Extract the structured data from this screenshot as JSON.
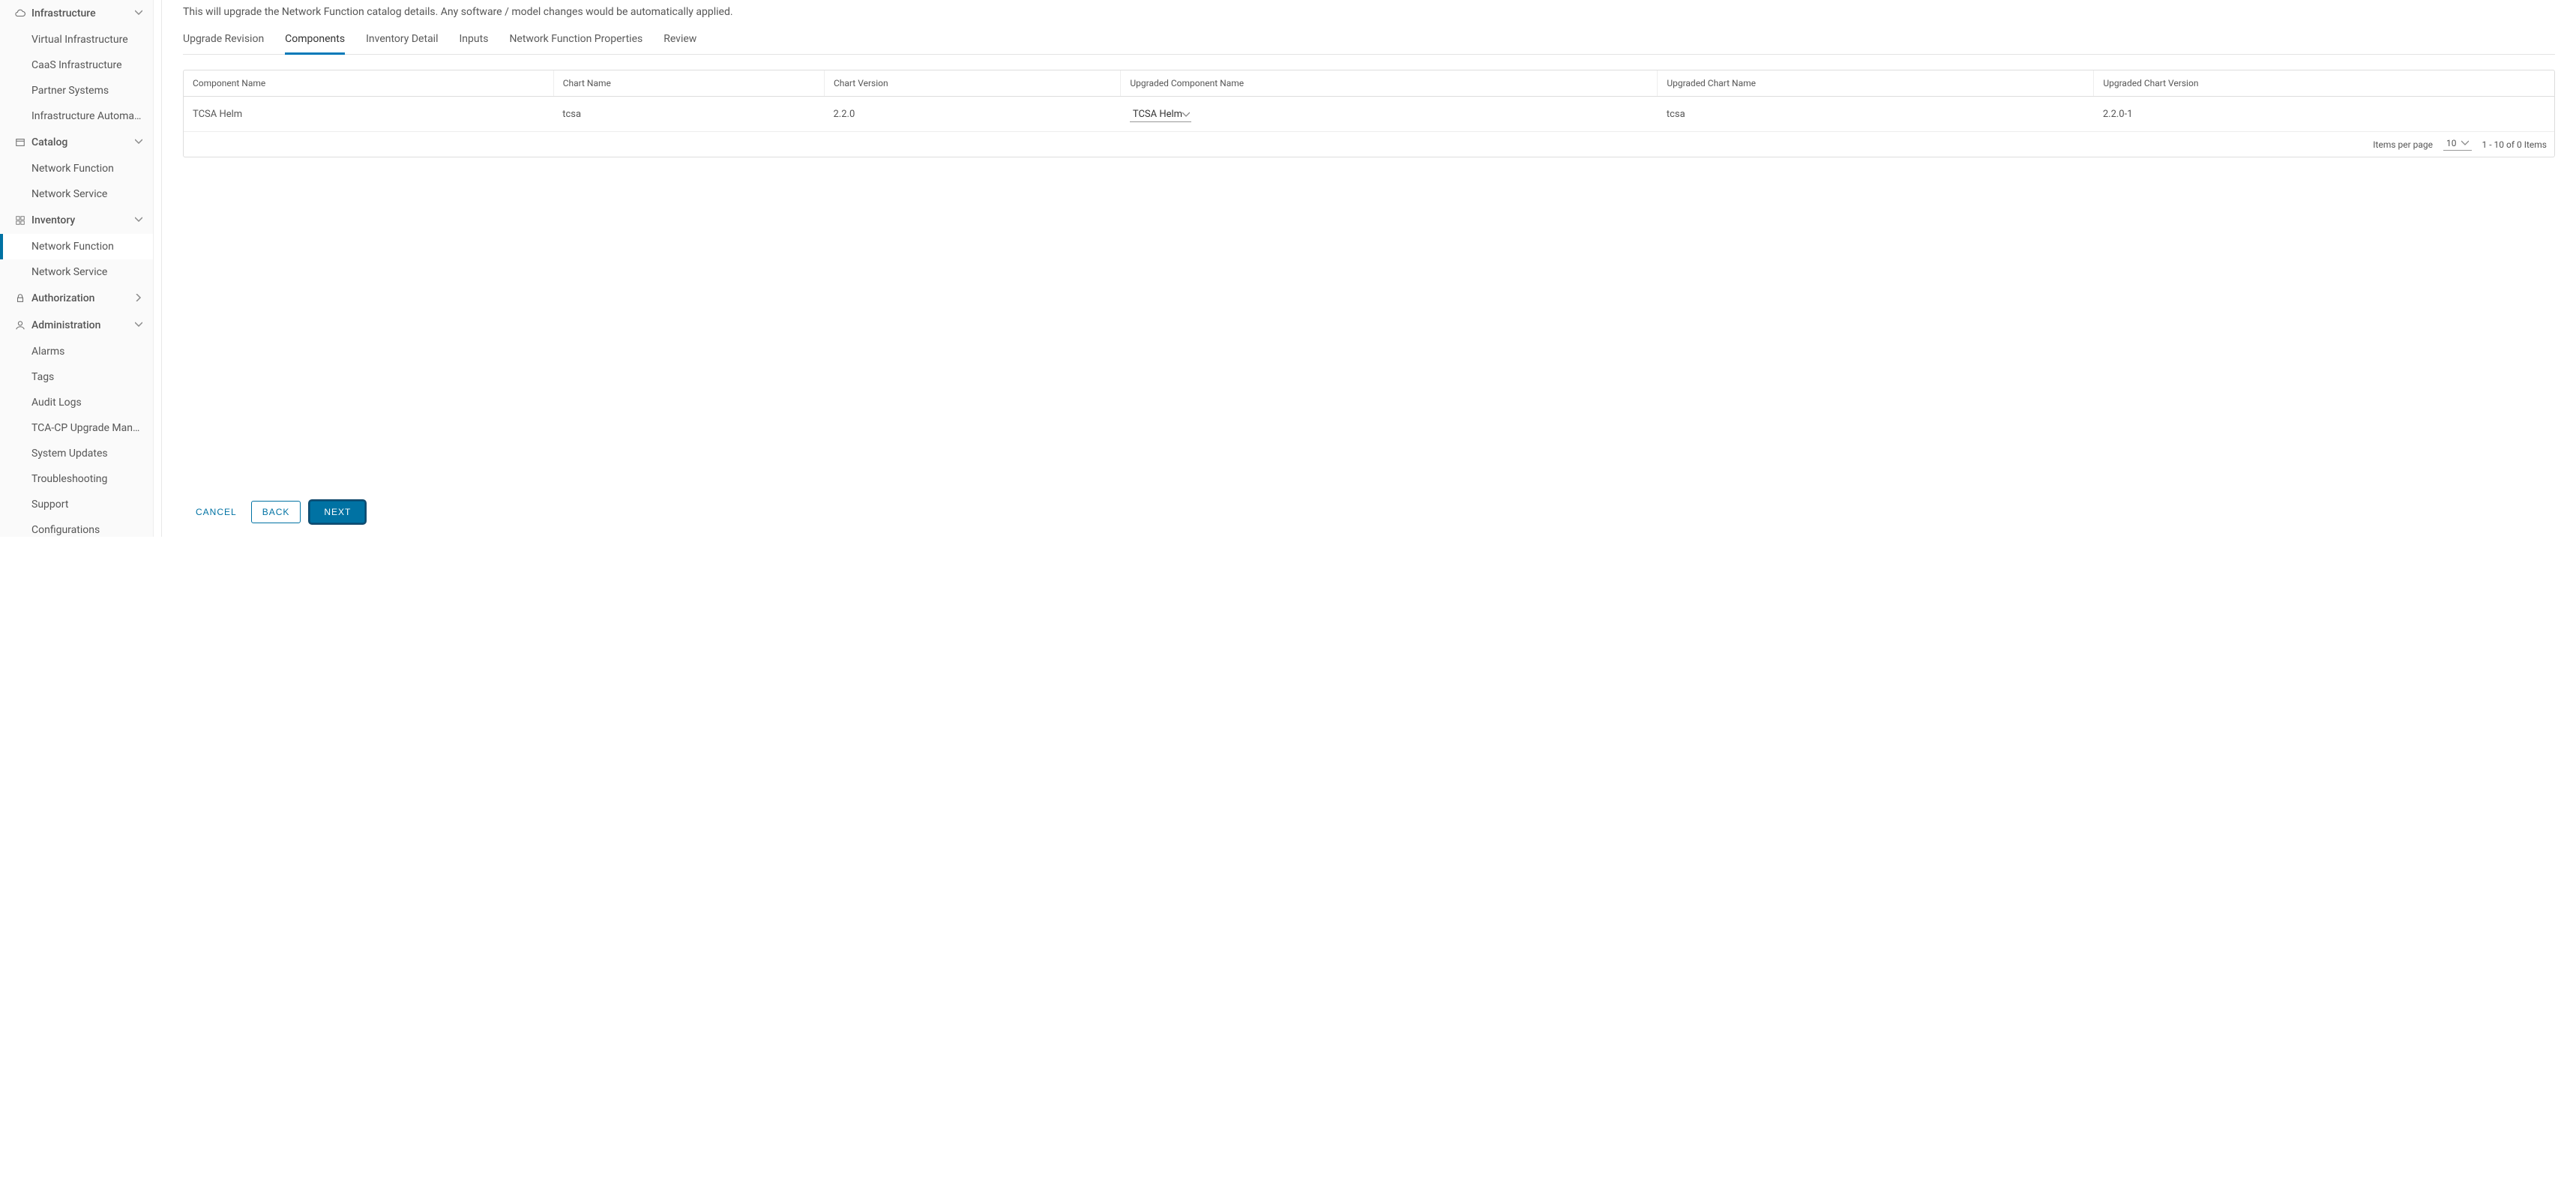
{
  "sidebar": {
    "groups": [
      {
        "key": "infrastructure",
        "label": "Infrastructure",
        "expanded": true,
        "icon": "cloud-icon",
        "items": [
          {
            "label": "Virtual Infrastructure"
          },
          {
            "label": "CaaS Infrastructure"
          },
          {
            "label": "Partner Systems"
          },
          {
            "label": "Infrastructure Automati..."
          }
        ]
      },
      {
        "key": "catalog",
        "label": "Catalog",
        "expanded": true,
        "icon": "catalog-icon",
        "items": [
          {
            "label": "Network Function"
          },
          {
            "label": "Network Service"
          }
        ]
      },
      {
        "key": "inventory",
        "label": "Inventory",
        "expanded": true,
        "icon": "grid-icon",
        "items": [
          {
            "label": "Network Function",
            "active": true
          },
          {
            "label": "Network Service"
          }
        ]
      },
      {
        "key": "authorization",
        "label": "Authorization",
        "expanded": false,
        "icon": "lock-icon",
        "items": []
      },
      {
        "key": "administration",
        "label": "Administration",
        "expanded": true,
        "icon": "user-icon",
        "items": [
          {
            "label": "Alarms"
          },
          {
            "label": "Tags"
          },
          {
            "label": "Audit Logs"
          },
          {
            "label": "TCA-CP Upgrade Mana..."
          },
          {
            "label": "System Updates"
          },
          {
            "label": "Troubleshooting"
          },
          {
            "label": "Support"
          },
          {
            "label": "Configurations"
          }
        ]
      }
    ]
  },
  "main": {
    "description": "This will upgrade the Network Function catalog details. Any software / model changes would be automatically applied.",
    "tabs": [
      {
        "label": "Upgrade Revision"
      },
      {
        "label": "Components",
        "active": true
      },
      {
        "label": "Inventory Detail"
      },
      {
        "label": "Inputs"
      },
      {
        "label": "Network Function Properties"
      },
      {
        "label": "Review"
      }
    ],
    "columns": [
      "Component Name",
      "Chart Name",
      "Chart Version",
      "Upgraded Component Name",
      "Upgraded Chart Name",
      "Upgraded Chart Version"
    ],
    "rows": [
      {
        "component_name": "TCSA Helm",
        "chart_name": "tcsa",
        "chart_version": "2.2.0",
        "upgraded_component_name": "TCSA Helm",
        "upgraded_chart_name": "tcsa",
        "upgraded_chart_version": "2.2.0-1"
      }
    ],
    "pagination": {
      "items_per_page_label": "Items per page",
      "page_size": "10",
      "range_text": "1 - 10 of 0 Items"
    },
    "actions": {
      "cancel": "CANCEL",
      "back": "BACK",
      "next": "NEXT"
    }
  }
}
